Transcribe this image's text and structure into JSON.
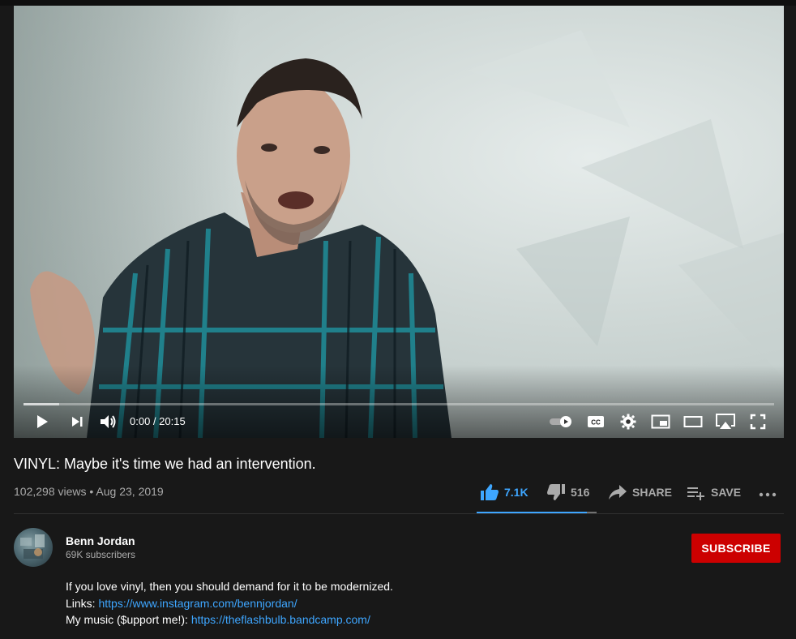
{
  "player": {
    "time_display": "0:00 / 20:15",
    "progress_fraction": 0,
    "buffered_fraction": 0.047
  },
  "video": {
    "title": "VINYL: Maybe it's time we had an intervention.",
    "meta": "102,298 views • Aug 23, 2019"
  },
  "actions": {
    "like_count": "7.1K",
    "dislike_count": "516",
    "share_label": "SHARE",
    "save_label": "SAVE"
  },
  "channel": {
    "name": "Benn Jordan",
    "subscribers": "69K subscribers",
    "subscribe_label": "SUBSCRIBE"
  },
  "description": {
    "line1": "If you love vinyl, then you should demand for it to be modernized.",
    "line2_prefix": "Links: ",
    "line2_link": "https://www.instagram.com/bennjordan/",
    "line3_prefix": "My music ($upport me!): ",
    "line3_link": "https://theflashbulb.bandcamp.com/"
  },
  "icons": [
    "play-icon",
    "next-icon",
    "volume-icon",
    "autoplay-toggle-icon",
    "cc-icon",
    "settings-icon",
    "miniplayer-icon",
    "theater-icon",
    "airplay-icon",
    "fullscreen-icon",
    "thumbs-up-icon",
    "thumbs-down-icon",
    "share-icon",
    "save-icon",
    "more-icon"
  ],
  "colors": {
    "accent": "#3ea6ff",
    "subscribe": "#cc0000",
    "background": "#181818"
  }
}
